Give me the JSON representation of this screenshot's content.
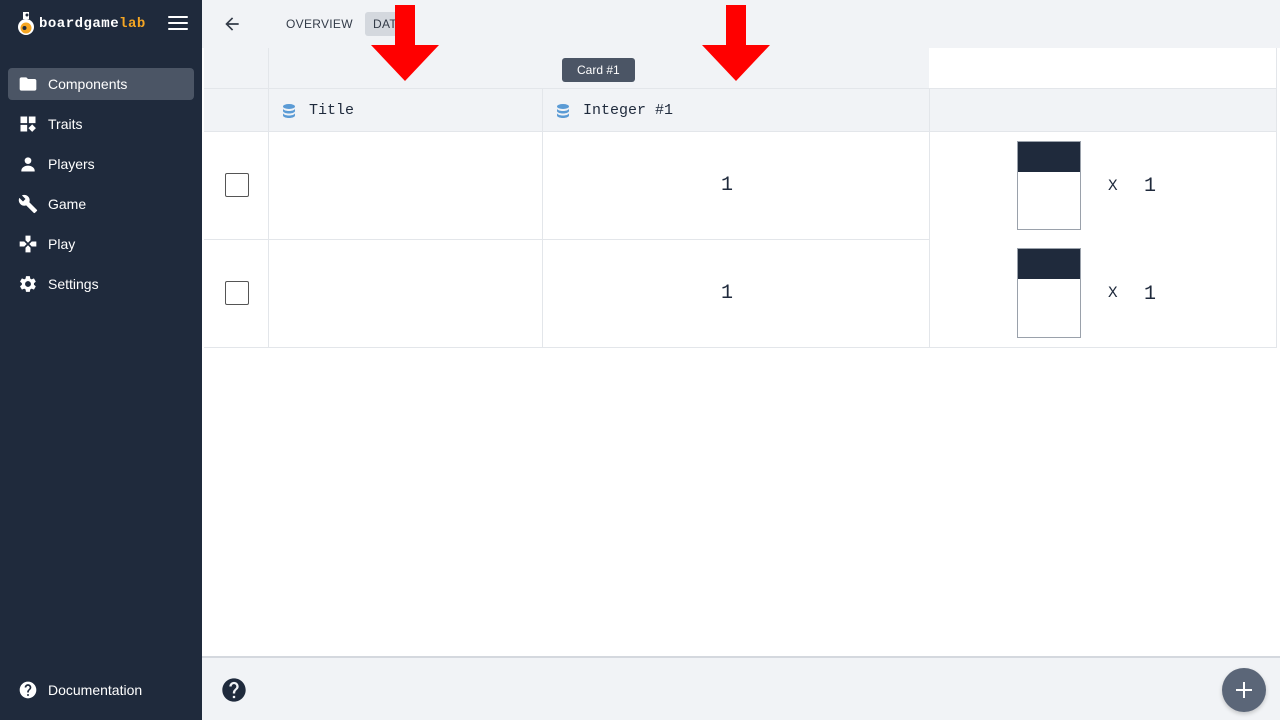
{
  "brand": {
    "name": "boardgame",
    "suffix": "lab"
  },
  "sidebar": {
    "items": [
      {
        "label": "Components",
        "icon": "folder-icon"
      },
      {
        "label": "Traits",
        "icon": "dashboard-icon"
      },
      {
        "label": "Players",
        "icon": "person-icon"
      },
      {
        "label": "Game",
        "icon": "wrench-icon"
      },
      {
        "label": "Play",
        "icon": "gamepad-icon"
      },
      {
        "label": "Settings",
        "icon": "gear-icon"
      }
    ],
    "active": "Components",
    "documentation": "Documentation"
  },
  "topbar": {
    "tabs": [
      {
        "label": "OVERVIEW"
      },
      {
        "label": "DAT"
      }
    ],
    "active_tab": "DAT"
  },
  "table": {
    "group_label": "Card #1",
    "columns": [
      {
        "label": "Title",
        "icon": "database-icon"
      },
      {
        "label": "Integer #1",
        "icon": "database-icon"
      }
    ],
    "rows": [
      {
        "title": "",
        "integer": "1",
        "qty_x": "X",
        "qty": "1"
      },
      {
        "title": "",
        "integer": "1",
        "qty_x": "X",
        "qty": "1"
      }
    ]
  },
  "colors": {
    "sidebar_bg": "#1f2a3c",
    "accent": "#f5a623",
    "annotation_arrow": "#ff0000",
    "fab": "#5b6678"
  }
}
